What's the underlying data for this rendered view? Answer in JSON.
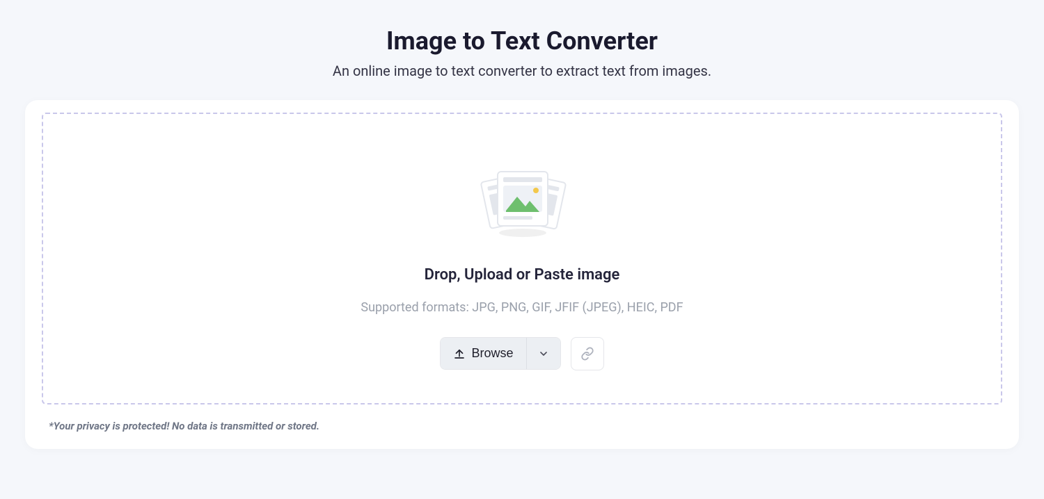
{
  "header": {
    "title": "Image to Text Converter",
    "subtitle": "An online image to text converter to extract text from images."
  },
  "dropzone": {
    "heading": "Drop, Upload or Paste image",
    "supported_line": "Supported formats: JPG, PNG, GIF, JFIF (JPEG), HEIC, PDF",
    "browse_label": "Browse"
  },
  "privacy_note": "*Your privacy is protected! No data is transmitted or stored.",
  "colors": {
    "dashed_border": "#c9c7ea",
    "muted_text": "#9aa0ab",
    "button_bg": "#eceff3"
  }
}
